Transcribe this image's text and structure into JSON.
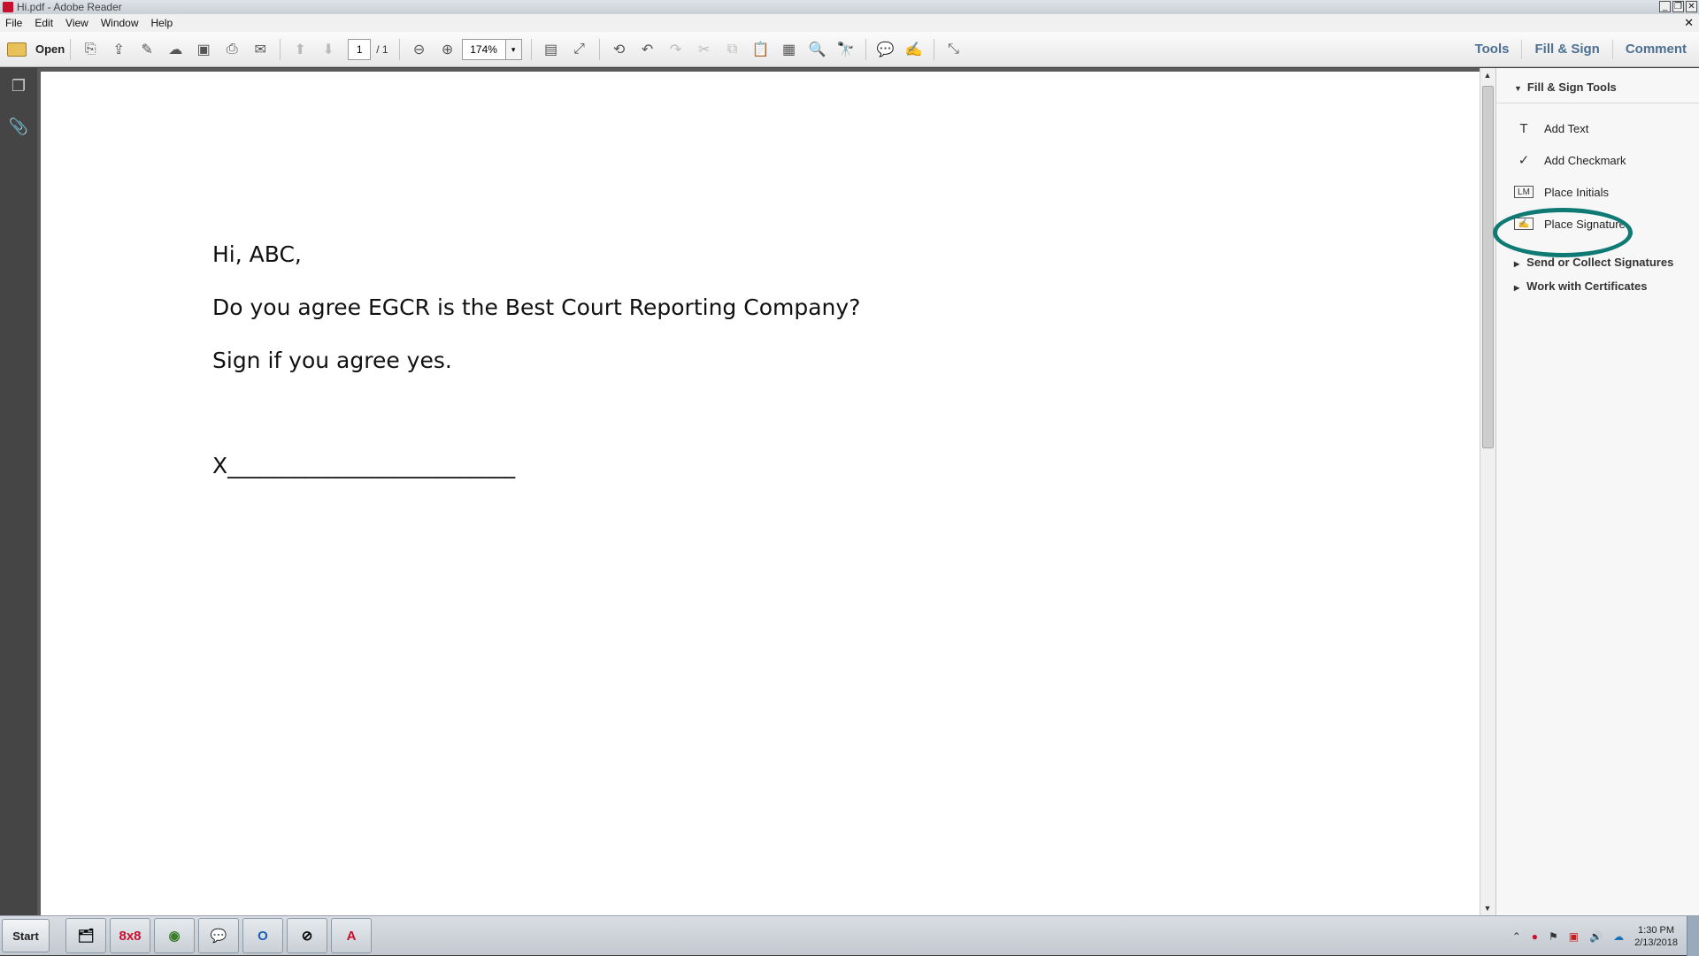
{
  "window": {
    "title": "Hi.pdf - Adobe Reader",
    "controls": [
      "_",
      "❐",
      "✕"
    ]
  },
  "menu": {
    "items": [
      "File",
      "Edit",
      "View",
      "Window",
      "Help"
    ],
    "doc_close": "✕"
  },
  "toolbar": {
    "open_label": "Open",
    "page_current": "1",
    "page_total": "/ 1",
    "zoom": "174%",
    "zoom_arrow": "▾",
    "tabs": [
      "Tools",
      "Fill & Sign",
      "Comment"
    ]
  },
  "document": {
    "lines": [
      "Hi, ABC,",
      "Do you agree EGCR is the Best Court Reporting Company?",
      "Sign if you agree yes.",
      "X__________________________"
    ]
  },
  "rightpane": {
    "header": "Fill & Sign Tools",
    "tools": [
      {
        "label": "Add Text",
        "icon": "T"
      },
      {
        "label": "Add Checkmark",
        "icon": "✓"
      },
      {
        "label": "Place Initials",
        "icon": "LM"
      },
      {
        "label": "Place Signature",
        "icon": "✍"
      }
    ],
    "sections": [
      "Send or Collect Signatures",
      "Work with Certificates"
    ],
    "highlight_color": "#0f7a74"
  },
  "taskbar": {
    "start_label": "Start",
    "apps": [
      {
        "name": "explorer",
        "glyph": "🗂"
      },
      {
        "name": "8x8",
        "glyph": "8x8"
      },
      {
        "name": "chrome",
        "glyph": "◉"
      },
      {
        "name": "chat",
        "glyph": "💬"
      },
      {
        "name": "outlook",
        "glyph": "O"
      },
      {
        "name": "app",
        "glyph": "⊘"
      },
      {
        "name": "acrobat",
        "glyph": "A"
      }
    ],
    "time": "1:30 PM",
    "date": "2/13/2018"
  }
}
